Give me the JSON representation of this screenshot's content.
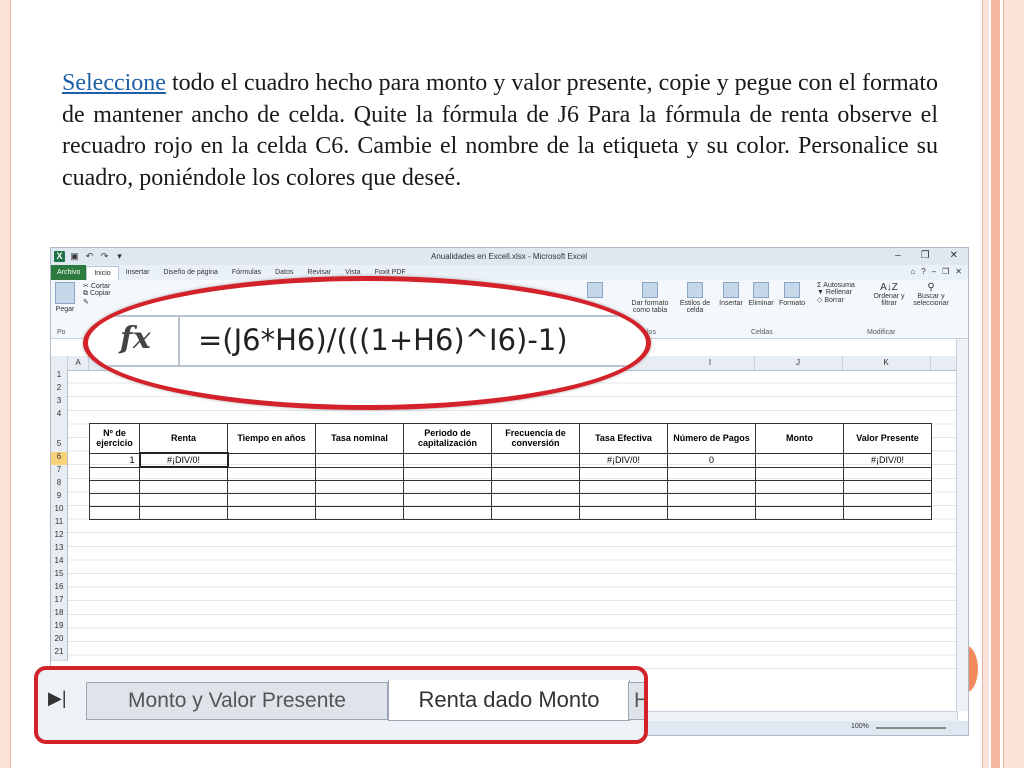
{
  "slide": {
    "text_link": "Seleccione",
    "text_rest": " todo el cuadro hecho para monto y valor presente, copie y pegue con el formato de mantener ancho de celda. Quite la fórmula de J6 Para la fórmula de renta observe el recuadro rojo en la celda C6. Cambie el nombre de la etiqueta y su color. Personalice su cuadro, poniéndole los colores que deseé."
  },
  "excel": {
    "title": "Anualidades en Excell.xlsx - Microsoft Excel",
    "menu_tabs": [
      "Archivo",
      "Inicio",
      "Insertar",
      "Diseño de página",
      "Fórmulas",
      "Datos",
      "Revisar",
      "Vista",
      "Foxit PDF"
    ],
    "ribbon": {
      "clipboard": {
        "paste": "Pegar",
        "cut": "Cortar",
        "copy": "Copiar",
        "group": "Po"
      },
      "styles": {
        "format_table": "Dar formato como tabla",
        "cell_styles": "Estilos de celda",
        "group": "los"
      },
      "cells": {
        "insert": "Insertar",
        "delete": "Eliminar",
        "format": "Formato",
        "group": "Celdas"
      },
      "editing": {
        "autosum": "Autosuma",
        "fill": "Rellenar",
        "clear": "Borrar",
        "sort": "Ordenar y filtrar",
        "find": "Buscar y seleccionar",
        "group": "Modificar"
      }
    },
    "column_headers": [
      "A",
      "I",
      "J",
      "K"
    ],
    "row_numbers": [
      "1",
      "2",
      "3",
      "4",
      "5",
      "6",
      "7",
      "8",
      "9",
      "10",
      "11",
      "12",
      "13",
      "14",
      "15",
      "16",
      "17",
      "18",
      "19",
      "20",
      "21"
    ],
    "table": {
      "headers": [
        "Nº de ejercicio",
        "Renta",
        "Tiempo en años",
        "Tasa nominal",
        "Periodo de capitalización",
        "Frecuencia de conversión",
        "Tasa Efectiva",
        "Número de Pagos",
        "Monto",
        "Valor Presente"
      ],
      "row6": [
        "1",
        "#¡DIV/0!",
        "",
        "",
        "",
        "",
        "#¡DIV/0!",
        "0",
        "",
        "#¡DIV/0!"
      ]
    },
    "zoom": "100%"
  },
  "callouts": {
    "fx_label": "fx",
    "formula": "=(J6*H6)/(((1+H6)^I6)-1)",
    "sheet_tabs": [
      "Monto y Valor Presente",
      "Renta dado Monto",
      "H"
    ]
  },
  "colors": {
    "callout_red": "#d4222a",
    "excel_green": "#1e7145",
    "link": "#1f5fa8"
  }
}
